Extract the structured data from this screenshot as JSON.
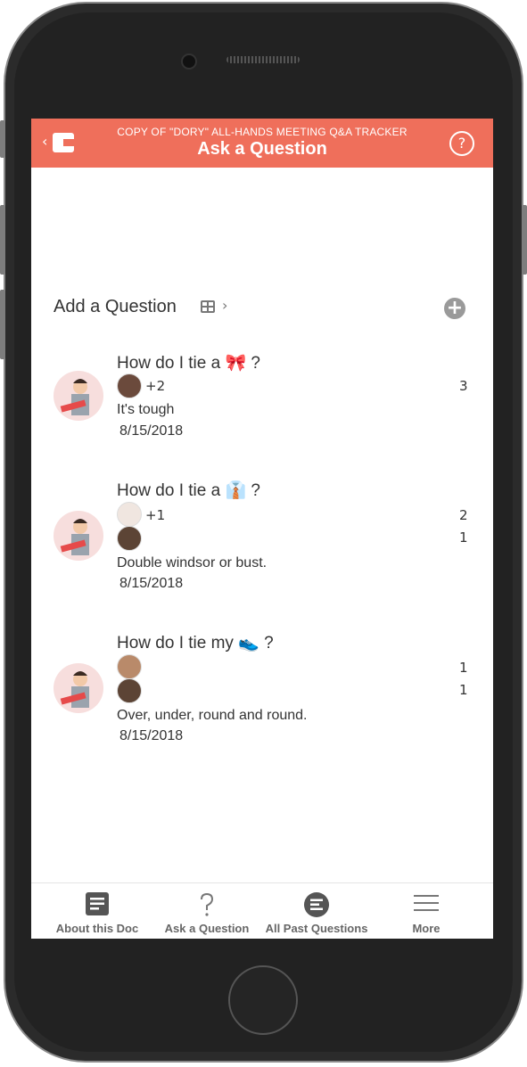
{
  "header": {
    "doc_title": "COPY OF \"DORY\" ALL-HANDS MEETING Q&A TRACKER",
    "page_title": "Ask a Question",
    "back_icon": "chevron-left-icon",
    "help_icon": "question-circle-icon"
  },
  "section": {
    "title": "Add a Question",
    "view_icon": "table-view-icon",
    "add_icon": "plus-circle-icon"
  },
  "questions": [
    {
      "title": "How do I tie a 🎀 ?",
      "voters_extra": "+2",
      "counts": [
        "3"
      ],
      "answer": "It's tough",
      "date": "8/15/2018"
    },
    {
      "title": "How do I tie a 👔 ?",
      "voters_extra": "+1",
      "counts": [
        "2",
        "1"
      ],
      "answer": "Double windsor or bust.",
      "date": "8/15/2018"
    },
    {
      "title": "How do I tie my 👟 ?",
      "voters_extra": "",
      "counts": [
        "1",
        "1"
      ],
      "answer": "Over, under, round and round.",
      "date": "8/15/2018"
    }
  ],
  "tabs": [
    {
      "label": "About this Doc",
      "icon": "doc-icon"
    },
    {
      "label": "Ask a Question",
      "icon": "question-mark-icon"
    },
    {
      "label": "All Past Questions",
      "icon": "list-icon"
    },
    {
      "label": "More",
      "icon": "menu-icon"
    }
  ],
  "colors": {
    "header": "#ef6f5b",
    "text": "#333333"
  }
}
